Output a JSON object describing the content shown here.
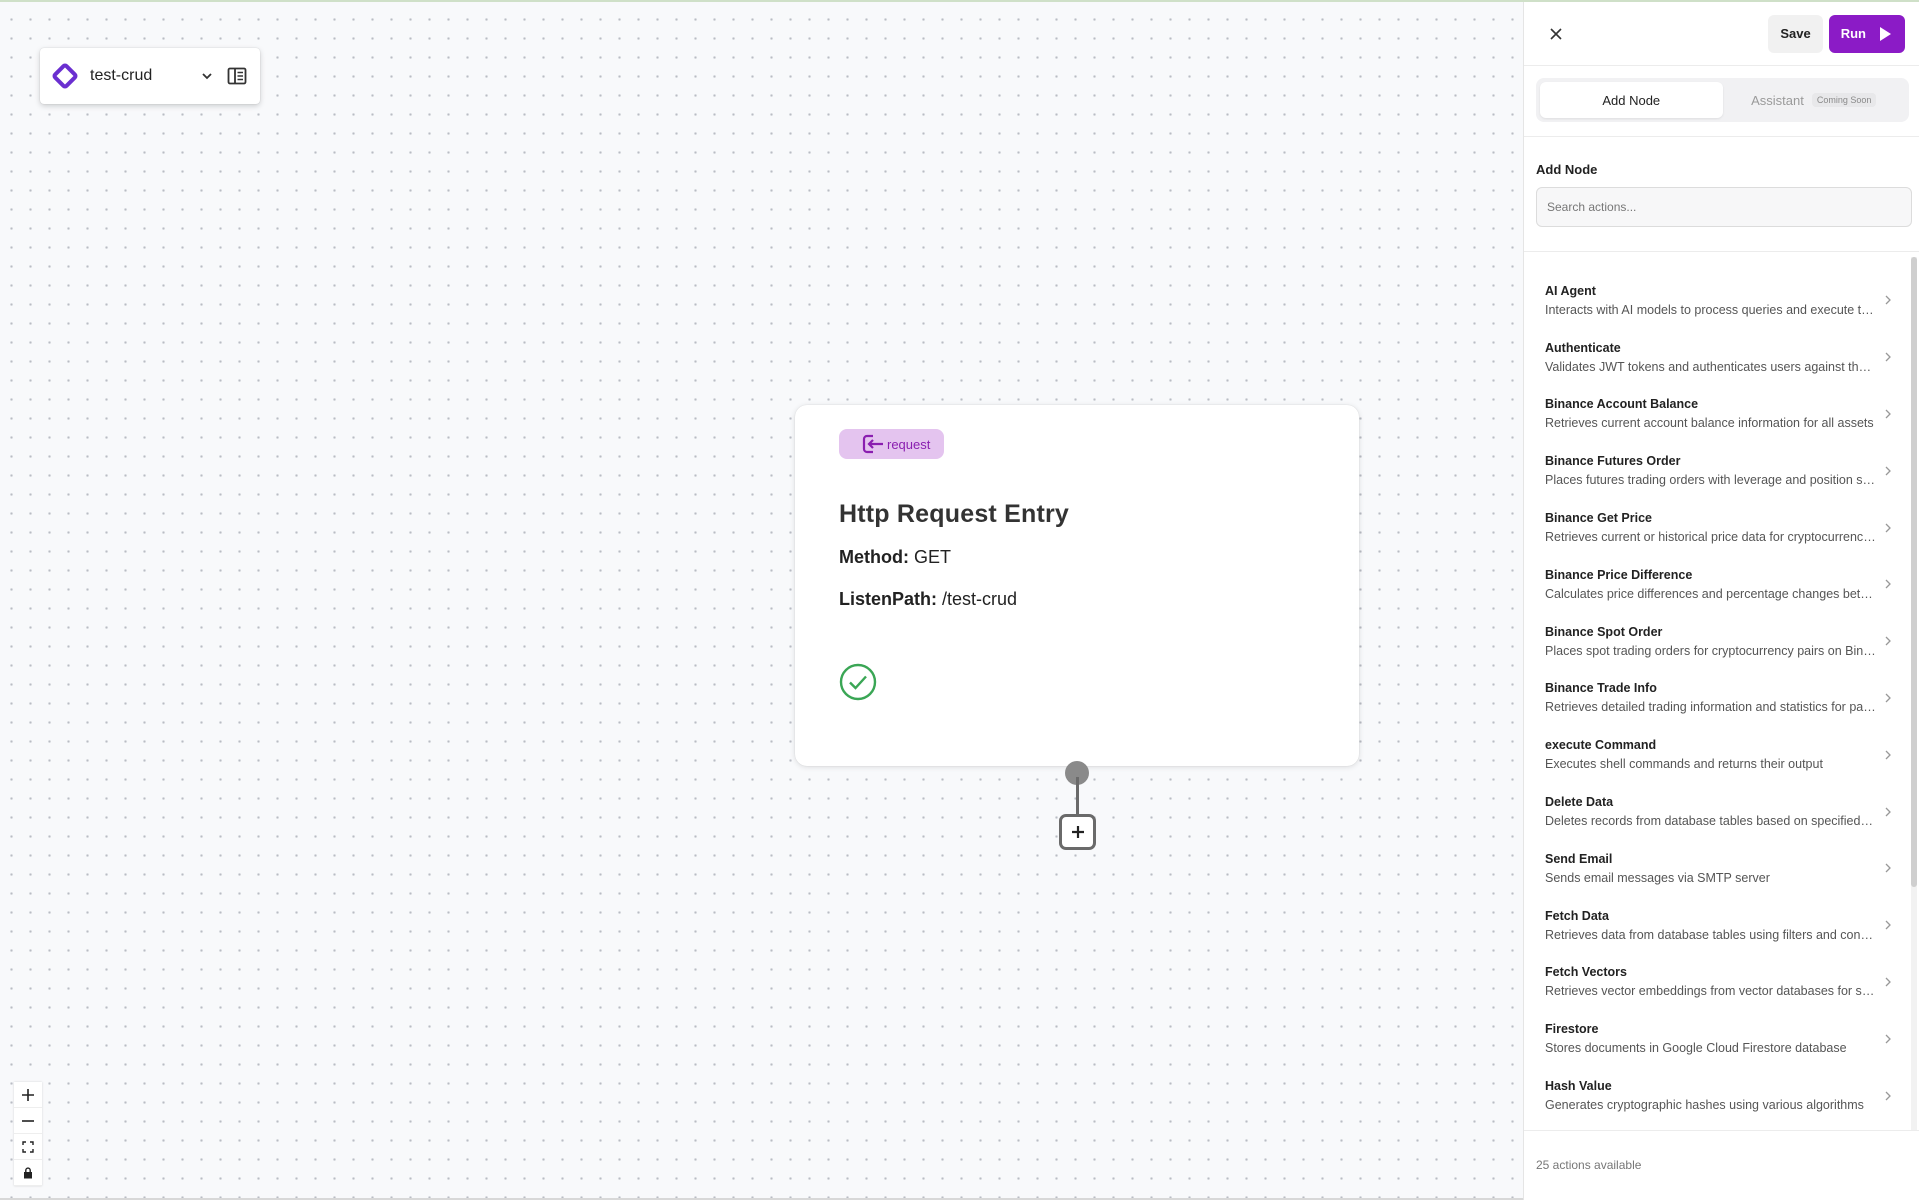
{
  "workflow": {
    "name": "test-crud"
  },
  "node": {
    "badge": "request",
    "title": "Http Request Entry",
    "method_label": "Method:",
    "method_value": "GET",
    "path_label": "ListenPath:",
    "path_value": "/test-crud"
  },
  "header": {
    "save_label": "Save",
    "run_label": "Run"
  },
  "tabs": [
    {
      "label": "Add Node",
      "active": true
    },
    {
      "label": "Assistant",
      "badge": "Coming Soon",
      "active": false
    }
  ],
  "add_node": {
    "title": "Add Node",
    "search_placeholder": "Search actions..."
  },
  "actions": [
    {
      "name": "AI Agent",
      "desc": "Interacts with AI models to process queries and execute tasks"
    },
    {
      "name": "Authenticate",
      "desc": "Validates JWT tokens and authenticates users against the database"
    },
    {
      "name": "Binance Account Balance",
      "desc": "Retrieves current account balance information for all assets"
    },
    {
      "name": "Binance Futures Order",
      "desc": "Places futures trading orders with leverage and position settings"
    },
    {
      "name": "Binance Get Price",
      "desc": "Retrieves current or historical price data for cryptocurrency pairs"
    },
    {
      "name": "Binance Price Difference",
      "desc": "Calculates price differences and percentage changes between pairs"
    },
    {
      "name": "Binance Spot Order",
      "desc": "Places spot trading orders for cryptocurrency pairs on Binance"
    },
    {
      "name": "Binance Trade Info",
      "desc": "Retrieves detailed trading information and statistics for pairs"
    },
    {
      "name": "execute Command",
      "desc": "Executes shell commands and returns their output"
    },
    {
      "name": "Delete Data",
      "desc": "Deletes records from database tables based on specified conditions"
    },
    {
      "name": "Send Email",
      "desc": "Sends email messages via SMTP server"
    },
    {
      "name": "Fetch Data",
      "desc": "Retrieves data from database tables using filters and conditions"
    },
    {
      "name": "Fetch Vectors",
      "desc": "Retrieves vector embeddings from vector databases for search"
    },
    {
      "name": "Firestore",
      "desc": "Stores documents in Google Cloud Firestore database"
    },
    {
      "name": "Hash Value",
      "desc": "Generates cryptographic hashes using various algorithms"
    }
  ],
  "footer": {
    "count_text": "25 actions available"
  },
  "colors": {
    "accent": "#8b1bc6",
    "badge_bg": "#e4c4ef",
    "success": "#3aa655"
  }
}
